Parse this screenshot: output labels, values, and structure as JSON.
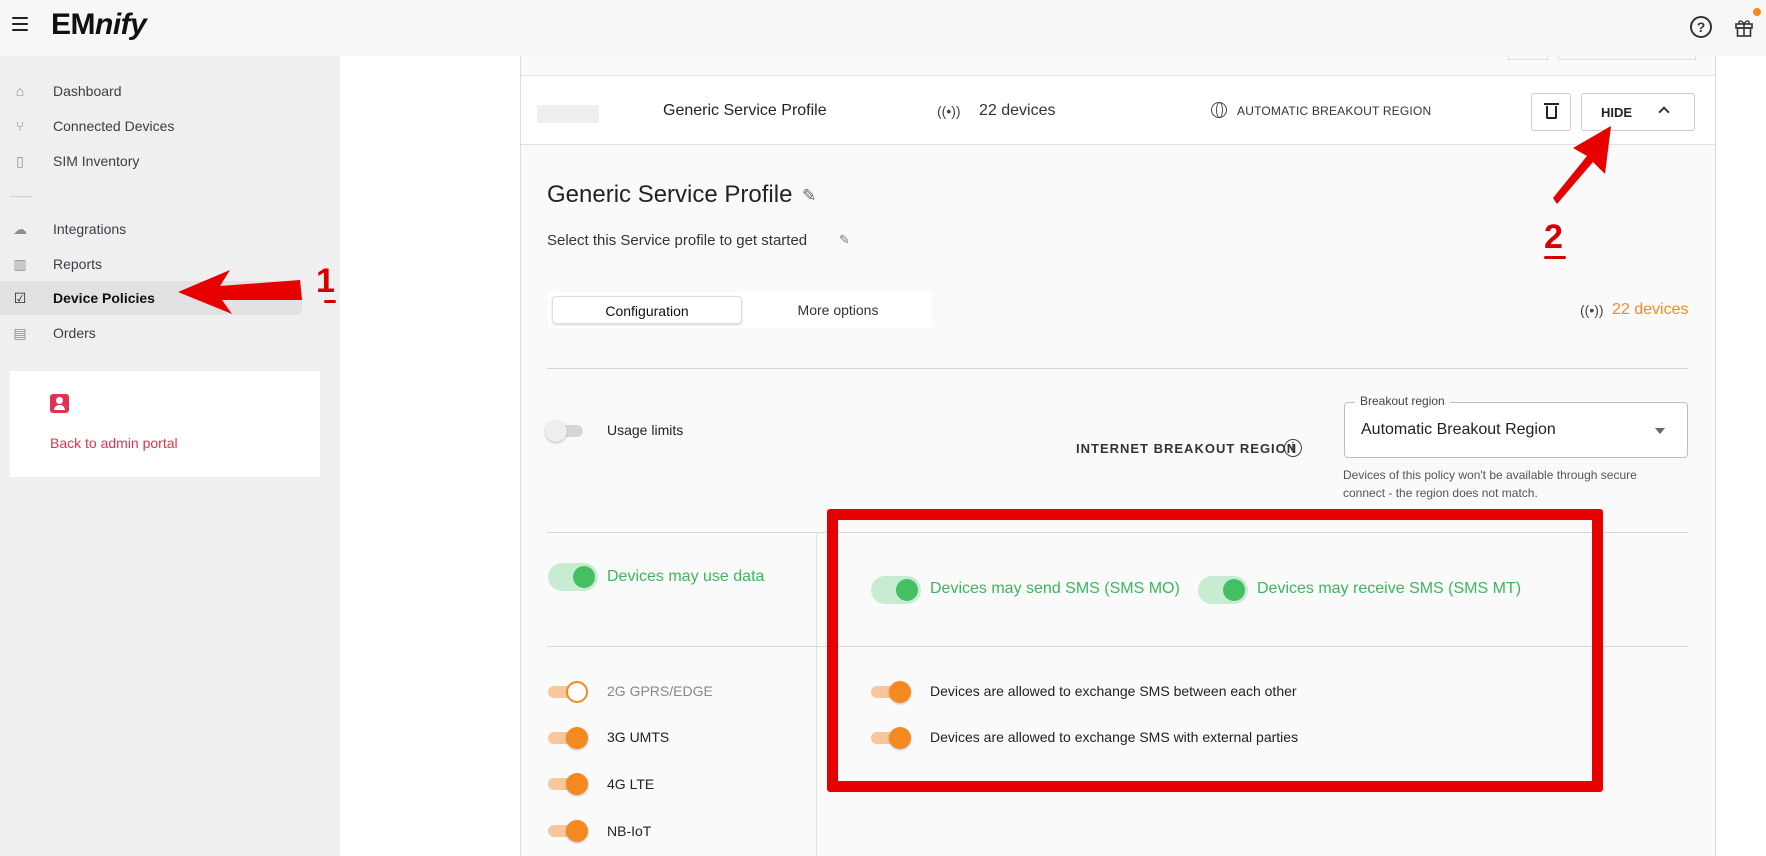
{
  "app": {
    "logo_prefix": "EM",
    "logo_suffix": "nify"
  },
  "sidebar": {
    "items": [
      {
        "label": "Dashboard",
        "icon": "home-icon"
      },
      {
        "label": "Connected Devices",
        "icon": "network-icon"
      },
      {
        "label": "SIM Inventory",
        "icon": "sim-icon"
      },
      {
        "label": "Integrations",
        "icon": "cloud-icon"
      },
      {
        "label": "Reports",
        "icon": "bar-chart-icon"
      },
      {
        "label": "Device Policies",
        "icon": "checkbox-icon",
        "active": true
      },
      {
        "label": "Orders",
        "icon": "document-icon"
      }
    ],
    "admin_link": "Back to admin portal"
  },
  "profile_row": {
    "name": "Generic Service Profile",
    "devices": "22 devices",
    "region": "AUTOMATIC BREAKOUT REGION",
    "hide_label": "HIDE"
  },
  "profile": {
    "title": "Generic Service Profile",
    "subtitle": "Select this Service profile to get started",
    "tabs": [
      "Configuration",
      "More options"
    ],
    "devices_count": "22 devices"
  },
  "settings": {
    "usage_limits": "Usage limits",
    "internet_breakout_label": "INTERNET BREAKOUT REGION",
    "breakout_legend": "Breakout region",
    "breakout_value": "Automatic Breakout Region",
    "breakout_helper": "Devices of this policy won't be available through secure connect - the region does not match.",
    "data_toggle": "Devices may use data",
    "sms_mo": "Devices may send SMS (SMS MO)",
    "sms_mt": "Devices may receive SMS (SMS MT)",
    "networks": [
      "2G GPRS/EDGE",
      "3G UMTS",
      "4G LTE",
      "NB-IoT"
    ],
    "sms_between": "Devices are allowed to exchange SMS between each other",
    "sms_external": "Devices are allowed to exchange SMS with external parties"
  },
  "annotations": {
    "step1": "1",
    "step2": "2"
  },
  "colors": {
    "accent": "#f5891f",
    "success": "#3bb75a",
    "annotation": "#e60000",
    "admin": "#e0334f"
  }
}
